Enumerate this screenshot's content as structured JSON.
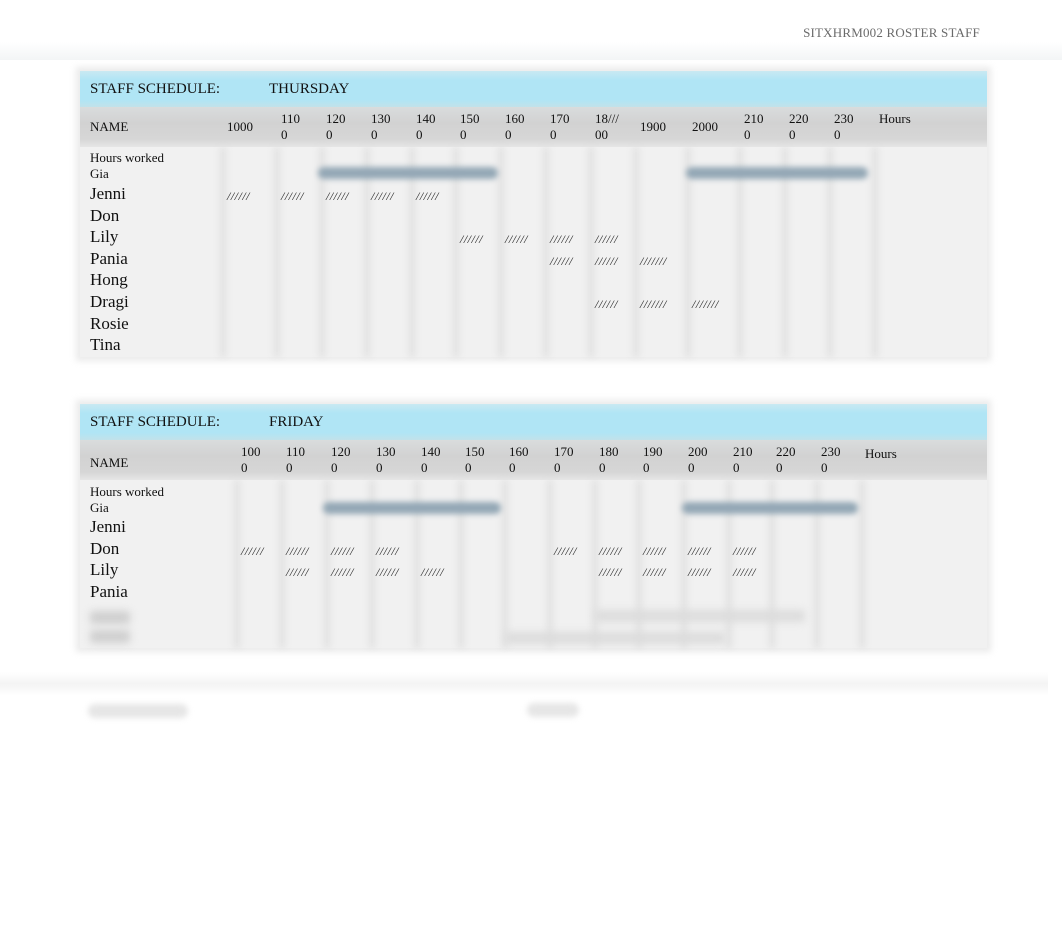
{
  "document": {
    "header": "SITXHRM002 ROSTER STAFF"
  },
  "schedules": [
    {
      "title_label": "STAFF SCHEDULE:",
      "day": "THURSDAY",
      "name_header": "NAME",
      "time_headers": [
        [
          "1000",
          ""
        ],
        [
          "110",
          "0"
        ],
        [
          "120",
          "0"
        ],
        [
          "130",
          "0"
        ],
        [
          "140",
          "0"
        ],
        [
          "150",
          "0"
        ],
        [
          "160",
          "0"
        ],
        [
          "170",
          "0"
        ],
        [
          "18///",
          "00"
        ],
        [
          "1900",
          ""
        ],
        [
          "2000",
          ""
        ],
        [
          "210",
          "0"
        ],
        [
          "220",
          "0"
        ],
        [
          "230",
          "0"
        ]
      ],
      "hours_header": "Hours",
      "hours_worked_label": "Hours worked",
      "staff": [
        {
          "name": "Gia",
          "shifts": []
        },
        {
          "name": "Jenni",
          "shifts": [
            {
              "col": 0,
              "mark": "//////"
            },
            {
              "col": 1,
              "mark": "//////"
            },
            {
              "col": 2,
              "mark": "//////"
            },
            {
              "col": 3,
              "mark": "//////"
            },
            {
              "col": 4,
              "mark": "//////"
            }
          ]
        },
        {
          "name": "Don",
          "shifts": []
        },
        {
          "name": "Lily",
          "shifts": [
            {
              "col": 5,
              "mark": "//////"
            },
            {
              "col": 6,
              "mark": "//////"
            },
            {
              "col": 7,
              "mark": "//////"
            },
            {
              "col": 8,
              "mark": "//////"
            }
          ]
        },
        {
          "name": "Pania",
          "shifts": [
            {
              "col": 7,
              "mark": "//////"
            },
            {
              "col": 8,
              "mark": "//////"
            },
            {
              "col": 9,
              "mark": "///////"
            }
          ]
        },
        {
          "name": "Hong",
          "shifts": []
        },
        {
          "name": "Dragi",
          "shifts": [
            {
              "col": 8,
              "mark": "//////"
            },
            {
              "col": 9,
              "mark": "///////"
            },
            {
              "col": 10,
              "mark": "///////"
            }
          ]
        },
        {
          "name": "Rosie",
          "shifts": []
        },
        {
          "name": "Tina",
          "shifts": []
        }
      ]
    },
    {
      "title_label": "STAFF SCHEDULE:",
      "day": "FRIDAY",
      "name_header": "NAME",
      "time_headers": [
        [
          "100",
          "0"
        ],
        [
          "110",
          "0"
        ],
        [
          "120",
          "0"
        ],
        [
          "130",
          "0"
        ],
        [
          "140",
          "0"
        ],
        [
          "150",
          "0"
        ],
        [
          "160",
          "0"
        ],
        [
          "170",
          "0"
        ],
        [
          "180",
          "0"
        ],
        [
          "190",
          "0"
        ],
        [
          "200",
          "0"
        ],
        [
          "210",
          "0"
        ],
        [
          "220",
          "0"
        ],
        [
          "230",
          "0"
        ]
      ],
      "hours_header": "Hours",
      "hours_worked_label": "Hours worked",
      "staff": [
        {
          "name": "Gia",
          "shifts": []
        },
        {
          "name": "Jenni",
          "shifts": []
        },
        {
          "name": "Don",
          "shifts": [
            {
              "col": 0,
              "mark": "//////"
            },
            {
              "col": 1,
              "mark": "//////"
            },
            {
              "col": 2,
              "mark": "//////"
            },
            {
              "col": 3,
              "mark": "//////"
            },
            {
              "col": 7,
              "mark": "//////"
            },
            {
              "col": 8,
              "mark": "//////"
            },
            {
              "col": 9,
              "mark": "//////"
            },
            {
              "col": 10,
              "mark": "//////"
            },
            {
              "col": 11,
              "mark": "//////"
            }
          ]
        },
        {
          "name": "Lily",
          "shifts": [
            {
              "col": 1,
              "mark": "//////"
            },
            {
              "col": 2,
              "mark": "//////"
            },
            {
              "col": 3,
              "mark": "//////"
            },
            {
              "col": 4,
              "mark": "//////"
            },
            {
              "col": 8,
              "mark": "//////"
            },
            {
              "col": 9,
              "mark": "//////"
            },
            {
              "col": 10,
              "mark": "//////"
            },
            {
              "col": 11,
              "mark": "//////"
            }
          ]
        },
        {
          "name": "Pania",
          "shifts": []
        }
      ]
    }
  ]
}
